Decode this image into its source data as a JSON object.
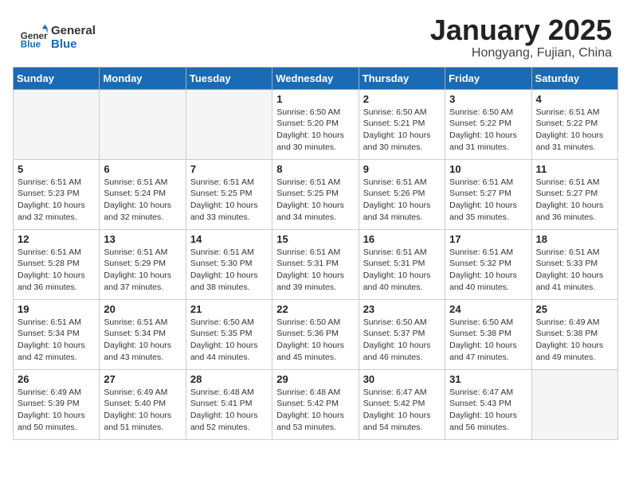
{
  "header": {
    "logo_line1": "General",
    "logo_line2": "Blue",
    "month_title": "January 2025",
    "location": "Hongyang, Fujian, China"
  },
  "weekdays": [
    "Sunday",
    "Monday",
    "Tuesday",
    "Wednesday",
    "Thursday",
    "Friday",
    "Saturday"
  ],
  "weeks": [
    [
      {
        "num": "",
        "info": ""
      },
      {
        "num": "",
        "info": ""
      },
      {
        "num": "",
        "info": ""
      },
      {
        "num": "1",
        "info": "Sunrise: 6:50 AM\nSunset: 5:20 PM\nDaylight: 10 hours\nand 30 minutes."
      },
      {
        "num": "2",
        "info": "Sunrise: 6:50 AM\nSunset: 5:21 PM\nDaylight: 10 hours\nand 30 minutes."
      },
      {
        "num": "3",
        "info": "Sunrise: 6:50 AM\nSunset: 5:22 PM\nDaylight: 10 hours\nand 31 minutes."
      },
      {
        "num": "4",
        "info": "Sunrise: 6:51 AM\nSunset: 5:22 PM\nDaylight: 10 hours\nand 31 minutes."
      }
    ],
    [
      {
        "num": "5",
        "info": "Sunrise: 6:51 AM\nSunset: 5:23 PM\nDaylight: 10 hours\nand 32 minutes."
      },
      {
        "num": "6",
        "info": "Sunrise: 6:51 AM\nSunset: 5:24 PM\nDaylight: 10 hours\nand 32 minutes."
      },
      {
        "num": "7",
        "info": "Sunrise: 6:51 AM\nSunset: 5:25 PM\nDaylight: 10 hours\nand 33 minutes."
      },
      {
        "num": "8",
        "info": "Sunrise: 6:51 AM\nSunset: 5:25 PM\nDaylight: 10 hours\nand 34 minutes."
      },
      {
        "num": "9",
        "info": "Sunrise: 6:51 AM\nSunset: 5:26 PM\nDaylight: 10 hours\nand 34 minutes."
      },
      {
        "num": "10",
        "info": "Sunrise: 6:51 AM\nSunset: 5:27 PM\nDaylight: 10 hours\nand 35 minutes."
      },
      {
        "num": "11",
        "info": "Sunrise: 6:51 AM\nSunset: 5:27 PM\nDaylight: 10 hours\nand 36 minutes."
      }
    ],
    [
      {
        "num": "12",
        "info": "Sunrise: 6:51 AM\nSunset: 5:28 PM\nDaylight: 10 hours\nand 36 minutes."
      },
      {
        "num": "13",
        "info": "Sunrise: 6:51 AM\nSunset: 5:29 PM\nDaylight: 10 hours\nand 37 minutes."
      },
      {
        "num": "14",
        "info": "Sunrise: 6:51 AM\nSunset: 5:30 PM\nDaylight: 10 hours\nand 38 minutes."
      },
      {
        "num": "15",
        "info": "Sunrise: 6:51 AM\nSunset: 5:31 PM\nDaylight: 10 hours\nand 39 minutes."
      },
      {
        "num": "16",
        "info": "Sunrise: 6:51 AM\nSunset: 5:31 PM\nDaylight: 10 hours\nand 40 minutes."
      },
      {
        "num": "17",
        "info": "Sunrise: 6:51 AM\nSunset: 5:32 PM\nDaylight: 10 hours\nand 40 minutes."
      },
      {
        "num": "18",
        "info": "Sunrise: 6:51 AM\nSunset: 5:33 PM\nDaylight: 10 hours\nand 41 minutes."
      }
    ],
    [
      {
        "num": "19",
        "info": "Sunrise: 6:51 AM\nSunset: 5:34 PM\nDaylight: 10 hours\nand 42 minutes."
      },
      {
        "num": "20",
        "info": "Sunrise: 6:51 AM\nSunset: 5:34 PM\nDaylight: 10 hours\nand 43 minutes."
      },
      {
        "num": "21",
        "info": "Sunrise: 6:50 AM\nSunset: 5:35 PM\nDaylight: 10 hours\nand 44 minutes."
      },
      {
        "num": "22",
        "info": "Sunrise: 6:50 AM\nSunset: 5:36 PM\nDaylight: 10 hours\nand 45 minutes."
      },
      {
        "num": "23",
        "info": "Sunrise: 6:50 AM\nSunset: 5:37 PM\nDaylight: 10 hours\nand 46 minutes."
      },
      {
        "num": "24",
        "info": "Sunrise: 6:50 AM\nSunset: 5:38 PM\nDaylight: 10 hours\nand 47 minutes."
      },
      {
        "num": "25",
        "info": "Sunrise: 6:49 AM\nSunset: 5:38 PM\nDaylight: 10 hours\nand 49 minutes."
      }
    ],
    [
      {
        "num": "26",
        "info": "Sunrise: 6:49 AM\nSunset: 5:39 PM\nDaylight: 10 hours\nand 50 minutes."
      },
      {
        "num": "27",
        "info": "Sunrise: 6:49 AM\nSunset: 5:40 PM\nDaylight: 10 hours\nand 51 minutes."
      },
      {
        "num": "28",
        "info": "Sunrise: 6:48 AM\nSunset: 5:41 PM\nDaylight: 10 hours\nand 52 minutes."
      },
      {
        "num": "29",
        "info": "Sunrise: 6:48 AM\nSunset: 5:42 PM\nDaylight: 10 hours\nand 53 minutes."
      },
      {
        "num": "30",
        "info": "Sunrise: 6:47 AM\nSunset: 5:42 PM\nDaylight: 10 hours\nand 54 minutes."
      },
      {
        "num": "31",
        "info": "Sunrise: 6:47 AM\nSunset: 5:43 PM\nDaylight: 10 hours\nand 56 minutes."
      },
      {
        "num": "",
        "info": ""
      }
    ]
  ]
}
